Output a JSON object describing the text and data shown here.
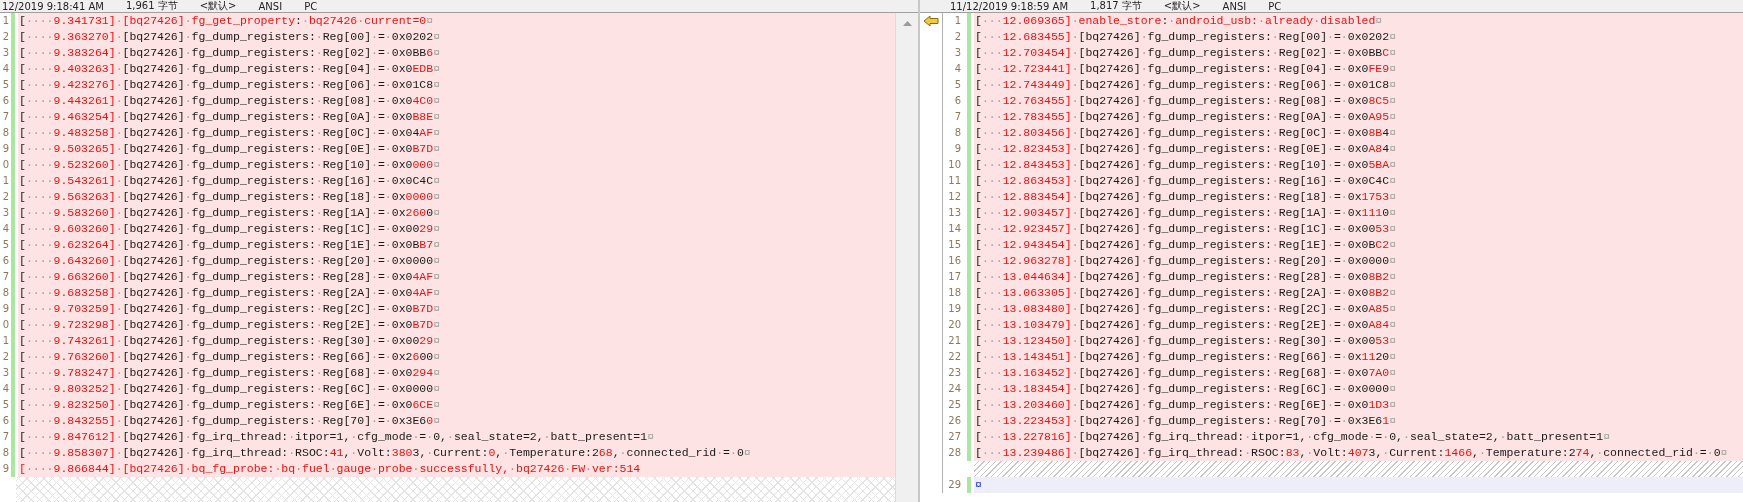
{
  "left": {
    "header": [
      "12/2019 9:18:41 AM",
      "1,961 字节",
      "<默认>",
      "ANSI",
      "PC"
    ],
    "lines": [
      {
        "num": "1",
        "kind": "changed",
        "segs": [
          {
            "text": "[····",
            "diff": false
          },
          {
            "text": "9.341731]",
            "diff": true
          },
          {
            "text": "·",
            "diff": false
          },
          {
            "text": "[bq27426]",
            "diff": true
          },
          {
            "text": "·",
            "diff": false
          },
          {
            "text": "fg_get_property",
            "diff": true
          },
          {
            "text": ":·",
            "diff": false
          },
          {
            "text": "bq27426·current=0",
            "diff": true
          },
          {
            "text": "¤",
            "diff": false
          }
        ]
      },
      {
        "num": "2",
        "kind": "changed",
        "segs": [
          {
            "text": "[····",
            "diff": false
          },
          {
            "text": "9.363270]",
            "diff": true
          },
          {
            "text": "·[bq27426]·fg_dump_registers:·Reg[00]·=·0x0202¤",
            "diff": false
          }
        ]
      },
      {
        "num": "3",
        "kind": "changed",
        "segs": [
          {
            "text": "[····",
            "diff": false
          },
          {
            "text": "9.383264]",
            "diff": true
          },
          {
            "text": "·[bq27426]·fg_dump_registers:·Reg[02]·=·0x0BB",
            "diff": false
          },
          {
            "text": "6",
            "diff": true
          },
          {
            "text": "¤",
            "diff": false
          }
        ]
      },
      {
        "num": "4",
        "kind": "changed",
        "segs": [
          {
            "text": "[····",
            "diff": false
          },
          {
            "text": "9.403263]",
            "diff": true
          },
          {
            "text": "·[bq27426]·fg_dump_registers:·Reg[04]·=·0x0",
            "diff": false
          },
          {
            "text": "EDB",
            "diff": true
          },
          {
            "text": "¤",
            "diff": false
          }
        ]
      },
      {
        "num": "5",
        "kind": "changed",
        "segs": [
          {
            "text": "[····",
            "diff": false
          },
          {
            "text": "9.423276]",
            "diff": true
          },
          {
            "text": "·[bq27426]·fg_dump_registers:·Reg[06]·=·0x01C8¤",
            "diff": false
          }
        ]
      },
      {
        "num": "6",
        "kind": "changed",
        "segs": [
          {
            "text": "[····",
            "diff": false
          },
          {
            "text": "9.443261]",
            "diff": true
          },
          {
            "text": "·[bq27426]·fg_dump_registers:·Reg[08]·=·0x0",
            "diff": false
          },
          {
            "text": "4C0",
            "diff": true
          },
          {
            "text": "¤",
            "diff": false
          }
        ]
      },
      {
        "num": "7",
        "kind": "changed",
        "segs": [
          {
            "text": "[····",
            "diff": false
          },
          {
            "text": "9.463254]",
            "diff": true
          },
          {
            "text": "·[bq27426]·fg_dump_registers:·Reg[0A]·=·0x0",
            "diff": false
          },
          {
            "text": "B8E",
            "diff": true
          },
          {
            "text": "¤",
            "diff": false
          }
        ]
      },
      {
        "num": "8",
        "kind": "changed",
        "segs": [
          {
            "text": "[····",
            "diff": false
          },
          {
            "text": "9.483258]",
            "diff": true
          },
          {
            "text": "·[bq27426]·fg_dump_registers:·Reg[0C]·=·0x04",
            "diff": false
          },
          {
            "text": "AF",
            "diff": true
          },
          {
            "text": "¤",
            "diff": false
          }
        ]
      },
      {
        "num": "9",
        "kind": "changed",
        "segs": [
          {
            "text": "[····",
            "diff": false
          },
          {
            "text": "9.503265]",
            "diff": true
          },
          {
            "text": "·[bq27426]·fg_dump_registers:·Reg[0E]·=·0x0",
            "diff": false
          },
          {
            "text": "B7D",
            "diff": true
          },
          {
            "text": "¤",
            "diff": false
          }
        ]
      },
      {
        "num": "0",
        "kind": "changed",
        "segs": [
          {
            "text": "[····",
            "diff": false
          },
          {
            "text": "9.523260]",
            "diff": true
          },
          {
            "text": "·[bq27426]·fg_dump_registers:·Reg[10]·=·0x0",
            "diff": false
          },
          {
            "text": "000",
            "diff": true
          },
          {
            "text": "¤",
            "diff": false
          }
        ]
      },
      {
        "num": "1",
        "kind": "changed",
        "segs": [
          {
            "text": "[····",
            "diff": false
          },
          {
            "text": "9.543261]",
            "diff": true
          },
          {
            "text": "·[bq27426]·fg_dump_registers:·Reg[16]·=·0x0C4C¤",
            "diff": false
          }
        ]
      },
      {
        "num": "2",
        "kind": "changed",
        "segs": [
          {
            "text": "[····",
            "diff": false
          },
          {
            "text": "9.563263]",
            "diff": true
          },
          {
            "text": "·[bq27426]·fg_dump_registers:·Reg[18]·=·0x",
            "diff": false
          },
          {
            "text": "0000",
            "diff": true
          },
          {
            "text": "¤",
            "diff": false
          }
        ]
      },
      {
        "num": "3",
        "kind": "changed",
        "segs": [
          {
            "text": "[····",
            "diff": false
          },
          {
            "text": "9.583260]",
            "diff": true
          },
          {
            "text": "·[bq27426]·fg_dump_registers:·Reg[1A]·=·0x",
            "diff": false
          },
          {
            "text": "260",
            "diff": true
          },
          {
            "text": "0¤",
            "diff": false
          }
        ]
      },
      {
        "num": "4",
        "kind": "changed",
        "segs": [
          {
            "text": "[····",
            "diff": false
          },
          {
            "text": "9.603260]",
            "diff": true
          },
          {
            "text": "·[bq27426]·fg_dump_registers:·Reg[1C]·=·0x00",
            "diff": false
          },
          {
            "text": "29",
            "diff": true
          },
          {
            "text": "¤",
            "diff": false
          }
        ]
      },
      {
        "num": "5",
        "kind": "changed",
        "segs": [
          {
            "text": "[····",
            "diff": false
          },
          {
            "text": "9.623264]",
            "diff": true
          },
          {
            "text": "·[bq27426]·fg_dump_registers:·Reg[1E]·=·0x0B",
            "diff": false
          },
          {
            "text": "B7",
            "diff": true
          },
          {
            "text": "¤",
            "diff": false
          }
        ]
      },
      {
        "num": "6",
        "kind": "changed",
        "segs": [
          {
            "text": "[····",
            "diff": false
          },
          {
            "text": "9.643260]",
            "diff": true
          },
          {
            "text": "·[bq27426]·fg_dump_registers:·Reg[20]·=·0x0000¤",
            "diff": false
          }
        ]
      },
      {
        "num": "7",
        "kind": "changed",
        "segs": [
          {
            "text": "[····",
            "diff": false
          },
          {
            "text": "9.663260]",
            "diff": true
          },
          {
            "text": "·[bq27426]·fg_dump_registers:·Reg[28]·=·0x0",
            "diff": false
          },
          {
            "text": "4AF",
            "diff": true
          },
          {
            "text": "¤",
            "diff": false
          }
        ]
      },
      {
        "num": "8",
        "kind": "changed",
        "segs": [
          {
            "text": "[····",
            "diff": false
          },
          {
            "text": "9.683258]",
            "diff": true
          },
          {
            "text": "·[bq27426]·fg_dump_registers:·Reg[2A]·=·0x0",
            "diff": false
          },
          {
            "text": "4AF",
            "diff": true
          },
          {
            "text": "¤",
            "diff": false
          }
        ]
      },
      {
        "num": "9",
        "kind": "changed",
        "segs": [
          {
            "text": "[····",
            "diff": false
          },
          {
            "text": "9.703259]",
            "diff": true
          },
          {
            "text": "·[bq27426]·fg_dump_registers:·Reg[2C]·=·0x0",
            "diff": false
          },
          {
            "text": "B7D",
            "diff": true
          },
          {
            "text": "¤",
            "diff": false
          }
        ]
      },
      {
        "num": "0",
        "kind": "changed",
        "segs": [
          {
            "text": "[····",
            "diff": false
          },
          {
            "text": "9.723298]",
            "diff": true
          },
          {
            "text": "·[bq27426]·fg_dump_registers:·Reg[2E]·=·0x0",
            "diff": false
          },
          {
            "text": "B7D",
            "diff": true
          },
          {
            "text": "¤",
            "diff": false
          }
        ]
      },
      {
        "num": "1",
        "kind": "changed",
        "segs": [
          {
            "text": "[····",
            "diff": false
          },
          {
            "text": "9.743261]",
            "diff": true
          },
          {
            "text": "·[bq27426]·fg_dump_registers:·Reg[30]·=·0x00",
            "diff": false
          },
          {
            "text": "29",
            "diff": true
          },
          {
            "text": "¤",
            "diff": false
          }
        ]
      },
      {
        "num": "2",
        "kind": "changed",
        "segs": [
          {
            "text": "[····",
            "diff": false
          },
          {
            "text": "9.763260]",
            "diff": true
          },
          {
            "text": "·[bq27426]·fg_dump_registers:·Reg[66]·=·0x2",
            "diff": false
          },
          {
            "text": "6",
            "diff": true
          },
          {
            "text": "00¤",
            "diff": false
          }
        ]
      },
      {
        "num": "3",
        "kind": "changed",
        "segs": [
          {
            "text": "[····",
            "diff": false
          },
          {
            "text": "9.783247]",
            "diff": true
          },
          {
            "text": "·[bq27426]·fg_dump_registers:·Reg[68]·=·0x0",
            "diff": false
          },
          {
            "text": "294",
            "diff": true
          },
          {
            "text": "¤",
            "diff": false
          }
        ]
      },
      {
        "num": "4",
        "kind": "changed",
        "segs": [
          {
            "text": "[····",
            "diff": false
          },
          {
            "text": "9.803252]",
            "diff": true
          },
          {
            "text": "·[bq27426]·fg_dump_registers:·Reg[6C]·=·0x0000¤",
            "diff": false
          }
        ]
      },
      {
        "num": "5",
        "kind": "changed",
        "segs": [
          {
            "text": "[····",
            "diff": false
          },
          {
            "text": "9.823250]",
            "diff": true
          },
          {
            "text": "·[bq27426]·fg_dump_registers:·Reg[6E]·=·0x0",
            "diff": false
          },
          {
            "text": "6CE",
            "diff": true
          },
          {
            "text": "¤",
            "diff": false
          }
        ]
      },
      {
        "num": "6",
        "kind": "changed",
        "segs": [
          {
            "text": "[····",
            "diff": false
          },
          {
            "text": "9.843255]",
            "diff": true
          },
          {
            "text": "·[bq27426]·fg_dump_registers:·Reg[70]·=·0x3E6",
            "diff": false
          },
          {
            "text": "0",
            "diff": true
          },
          {
            "text": "¤",
            "diff": false
          }
        ]
      },
      {
        "num": "7",
        "kind": "changed",
        "segs": [
          {
            "text": "[····",
            "diff": false
          },
          {
            "text": "9.847612]",
            "diff": true
          },
          {
            "text": "·[bq27426]·fg_irq_thread:·itpor=1,·cfg_mode·=·0,·seal_state=2,·batt_present=1¤",
            "diff": false
          }
        ]
      },
      {
        "num": "8",
        "kind": "changed",
        "segs": [
          {
            "text": "[····",
            "diff": false
          },
          {
            "text": "9.858307]",
            "diff": true
          },
          {
            "text": "·[bq27426]·fg_irq_thread:·RSOC:",
            "diff": false
          },
          {
            "text": "41",
            "diff": true
          },
          {
            "text": ",·Volt:",
            "diff": false
          },
          {
            "text": "380",
            "diff": true
          },
          {
            "text": "3,·Current:",
            "diff": false
          },
          {
            "text": "0",
            "diff": true
          },
          {
            "text": ",·Temperature:2",
            "diff": false
          },
          {
            "text": "68",
            "diff": true
          },
          {
            "text": ",·connected_rid·=·0¤",
            "diff": false
          }
        ]
      },
      {
        "num": "9",
        "kind": "changed",
        "segs": [
          {
            "text": "[····9.866844]·[bq27426]·bq_fg_probe:·bq·fuel·gauge·probe·successfully,·bq27426·FW·ver:514",
            "diff": true
          }
        ]
      }
    ]
  },
  "right": {
    "header": [
      "11/12/2019 9:18:59 AM",
      "1,817 字节",
      "<默认>",
      "ANSI",
      "PC"
    ],
    "lines": [
      {
        "num": "1",
        "kind": "changed",
        "current": true,
        "segs": [
          {
            "text": "[···",
            "diff": false
          },
          {
            "text": "12.069365]",
            "diff": true
          },
          {
            "text": "·",
            "diff": false
          },
          {
            "text": "enable_store",
            "diff": true
          },
          {
            "text": ":·",
            "diff": false
          },
          {
            "text": "android_usb:·already·disabled",
            "diff": true
          },
          {
            "text": "¤",
            "diff": false
          }
        ]
      },
      {
        "num": "2",
        "kind": "changed",
        "current": false,
        "segs": [
          {
            "text": "[···",
            "diff": false
          },
          {
            "text": "12.683455]",
            "diff": true
          },
          {
            "text": "·[bq27426]·fg_dump_registers:·Reg[00]·=·0x0202¤",
            "diff": false
          }
        ]
      },
      {
        "num": "3",
        "kind": "changed",
        "current": false,
        "segs": [
          {
            "text": "[···",
            "diff": false
          },
          {
            "text": "12.703454]",
            "diff": true
          },
          {
            "text": "·[bq27426]·fg_dump_registers:·Reg[02]·=·0x0BB",
            "diff": false
          },
          {
            "text": "C",
            "diff": true
          },
          {
            "text": "¤",
            "diff": false
          }
        ]
      },
      {
        "num": "4",
        "kind": "changed",
        "current": false,
        "segs": [
          {
            "text": "[···",
            "diff": false
          },
          {
            "text": "12.723441]",
            "diff": true
          },
          {
            "text": "·[bq27426]·fg_dump_registers:·Reg[04]·=·0x0",
            "diff": false
          },
          {
            "text": "FE9",
            "diff": true
          },
          {
            "text": "¤",
            "diff": false
          }
        ]
      },
      {
        "num": "5",
        "kind": "changed",
        "current": false,
        "segs": [
          {
            "text": "[···",
            "diff": false
          },
          {
            "text": "12.743449]",
            "diff": true
          },
          {
            "text": "·[bq27426]·fg_dump_registers:·Reg[06]·=·0x01C8¤",
            "diff": false
          }
        ]
      },
      {
        "num": "6",
        "kind": "changed",
        "current": false,
        "segs": [
          {
            "text": "[···",
            "diff": false
          },
          {
            "text": "12.763455]",
            "diff": true
          },
          {
            "text": "·[bq27426]·fg_dump_registers:·Reg[08]·=·0x0",
            "diff": false
          },
          {
            "text": "8C5",
            "diff": true
          },
          {
            "text": "¤",
            "diff": false
          }
        ]
      },
      {
        "num": "7",
        "kind": "changed",
        "current": false,
        "segs": [
          {
            "text": "[···",
            "diff": false
          },
          {
            "text": "12.783455]",
            "diff": true
          },
          {
            "text": "·[bq27426]·fg_dump_registers:·Reg[0A]·=·0x0",
            "diff": false
          },
          {
            "text": "A95",
            "diff": true
          },
          {
            "text": "¤",
            "diff": false
          }
        ]
      },
      {
        "num": "8",
        "kind": "changed",
        "current": false,
        "segs": [
          {
            "text": "[···",
            "diff": false
          },
          {
            "text": "12.803456]",
            "diff": true
          },
          {
            "text": "·[bq27426]·fg_dump_registers:·Reg[0C]·=·0x0",
            "diff": false
          },
          {
            "text": "8B",
            "diff": true
          },
          {
            "text": "4¤",
            "diff": false
          }
        ]
      },
      {
        "num": "9",
        "kind": "changed",
        "current": false,
        "segs": [
          {
            "text": "[···",
            "diff": false
          },
          {
            "text": "12.823453]",
            "diff": true
          },
          {
            "text": "·[bq27426]·fg_dump_registers:·Reg[0E]·=·0x0",
            "diff": false
          },
          {
            "text": "A8",
            "diff": true
          },
          {
            "text": "4¤",
            "diff": false
          }
        ]
      },
      {
        "num": "10",
        "kind": "changed",
        "current": false,
        "segs": [
          {
            "text": "[···",
            "diff": false
          },
          {
            "text": "12.843453]",
            "diff": true
          },
          {
            "text": "·[bq27426]·fg_dump_registers:·Reg[10]·=·0x0",
            "diff": false
          },
          {
            "text": "5BA",
            "diff": true
          },
          {
            "text": "¤",
            "diff": false
          }
        ]
      },
      {
        "num": "11",
        "kind": "changed",
        "current": false,
        "segs": [
          {
            "text": "[···",
            "diff": false
          },
          {
            "text": "12.863453]",
            "diff": true
          },
          {
            "text": "·[bq27426]·fg_dump_registers:·Reg[16]·=·0x0C4C¤",
            "diff": false
          }
        ]
      },
      {
        "num": "12",
        "kind": "changed",
        "current": false,
        "segs": [
          {
            "text": "[···",
            "diff": false
          },
          {
            "text": "12.883454]",
            "diff": true
          },
          {
            "text": "·[bq27426]·fg_dump_registers:·Reg[18]·=·0x",
            "diff": false
          },
          {
            "text": "1753",
            "diff": true
          },
          {
            "text": "¤",
            "diff": false
          }
        ]
      },
      {
        "num": "13",
        "kind": "changed",
        "current": false,
        "segs": [
          {
            "text": "[···",
            "diff": false
          },
          {
            "text": "12.903457]",
            "diff": true
          },
          {
            "text": "·[bq27426]·fg_dump_registers:·Reg[1A]·=·0x",
            "diff": false
          },
          {
            "text": "111",
            "diff": true
          },
          {
            "text": "0¤",
            "diff": false
          }
        ]
      },
      {
        "num": "14",
        "kind": "changed",
        "current": false,
        "segs": [
          {
            "text": "[···",
            "diff": false
          },
          {
            "text": "12.923457]",
            "diff": true
          },
          {
            "text": "·[bq27426]·fg_dump_registers:·Reg[1C]·=·0x00",
            "diff": false
          },
          {
            "text": "53",
            "diff": true
          },
          {
            "text": "¤",
            "diff": false
          }
        ]
      },
      {
        "num": "15",
        "kind": "changed",
        "current": false,
        "segs": [
          {
            "text": "[···",
            "diff": false
          },
          {
            "text": "12.943454]",
            "diff": true
          },
          {
            "text": "·[bq27426]·fg_dump_registers:·Reg[1E]·=·0x0B",
            "diff": false
          },
          {
            "text": "C2",
            "diff": true
          },
          {
            "text": "¤",
            "diff": false
          }
        ]
      },
      {
        "num": "16",
        "kind": "changed",
        "current": false,
        "segs": [
          {
            "text": "[···",
            "diff": false
          },
          {
            "text": "12.963278]",
            "diff": true
          },
          {
            "text": "·[bq27426]·fg_dump_registers:·Reg[20]·=·0x0000¤",
            "diff": false
          }
        ]
      },
      {
        "num": "17",
        "kind": "changed",
        "current": false,
        "segs": [
          {
            "text": "[···",
            "diff": false
          },
          {
            "text": "13.044634]",
            "diff": true
          },
          {
            "text": "·[bq27426]·fg_dump_registers:·Reg[28]·=·0x0",
            "diff": false
          },
          {
            "text": "8B2",
            "diff": true
          },
          {
            "text": "¤",
            "diff": false
          }
        ]
      },
      {
        "num": "18",
        "kind": "changed",
        "current": false,
        "segs": [
          {
            "text": "[···",
            "diff": false
          },
          {
            "text": "13.063305]",
            "diff": true
          },
          {
            "text": "·[bq27426]·fg_dump_registers:·Reg[2A]·=·0x0",
            "diff": false
          },
          {
            "text": "8B2",
            "diff": true
          },
          {
            "text": "¤",
            "diff": false
          }
        ]
      },
      {
        "num": "19",
        "kind": "changed",
        "current": false,
        "segs": [
          {
            "text": "[···",
            "diff": false
          },
          {
            "text": "13.083480]",
            "diff": true
          },
          {
            "text": "·[bq27426]·fg_dump_registers:·Reg[2C]·=·0x0",
            "diff": false
          },
          {
            "text": "A85",
            "diff": true
          },
          {
            "text": "¤",
            "diff": false
          }
        ]
      },
      {
        "num": "20",
        "kind": "changed",
        "current": false,
        "segs": [
          {
            "text": "[···",
            "diff": false
          },
          {
            "text": "13.103479]",
            "diff": true
          },
          {
            "text": "·[bq27426]·fg_dump_registers:·Reg[2E]·=·0x0",
            "diff": false
          },
          {
            "text": "A84",
            "diff": true
          },
          {
            "text": "¤",
            "diff": false
          }
        ]
      },
      {
        "num": "21",
        "kind": "changed",
        "current": false,
        "segs": [
          {
            "text": "[···",
            "diff": false
          },
          {
            "text": "13.123450]",
            "diff": true
          },
          {
            "text": "·[bq27426]·fg_dump_registers:·Reg[30]·=·0x00",
            "diff": false
          },
          {
            "text": "53",
            "diff": true
          },
          {
            "text": "¤",
            "diff": false
          }
        ]
      },
      {
        "num": "22",
        "kind": "changed",
        "current": false,
        "segs": [
          {
            "text": "[···",
            "diff": false
          },
          {
            "text": "13.143451]",
            "diff": true
          },
          {
            "text": "·[bq27426]·fg_dump_registers:·Reg[66]·=·0x",
            "diff": false
          },
          {
            "text": "11",
            "diff": true
          },
          {
            "text": "20¤",
            "diff": false
          }
        ]
      },
      {
        "num": "23",
        "kind": "changed",
        "current": false,
        "segs": [
          {
            "text": "[···",
            "diff": false
          },
          {
            "text": "13.163452]",
            "diff": true
          },
          {
            "text": "·[bq27426]·fg_dump_registers:·Reg[68]·=·0x0",
            "diff": false
          },
          {
            "text": "7A0",
            "diff": true
          },
          {
            "text": "¤",
            "diff": false
          }
        ]
      },
      {
        "num": "24",
        "kind": "changed",
        "current": false,
        "segs": [
          {
            "text": "[···",
            "diff": false
          },
          {
            "text": "13.183454]",
            "diff": true
          },
          {
            "text": "·[bq27426]·fg_dump_registers:·Reg[6C]·=·0x0000¤",
            "diff": false
          }
        ]
      },
      {
        "num": "25",
        "kind": "changed",
        "current": false,
        "segs": [
          {
            "text": "[···",
            "diff": false
          },
          {
            "text": "13.203460]",
            "diff": true
          },
          {
            "text": "·[bq27426]·fg_dump_registers:·Reg[6E]·=·0x0",
            "diff": false
          },
          {
            "text": "1D3",
            "diff": true
          },
          {
            "text": "¤",
            "diff": false
          }
        ]
      },
      {
        "num": "26",
        "kind": "changed",
        "current": false,
        "segs": [
          {
            "text": "[···",
            "diff": false
          },
          {
            "text": "13.223453]",
            "diff": true
          },
          {
            "text": "·[bq27426]·fg_dump_registers:·Reg[70]·=·0x3E6",
            "diff": false
          },
          {
            "text": "1",
            "diff": true
          },
          {
            "text": "¤",
            "diff": false
          }
        ]
      },
      {
        "num": "27",
        "kind": "changed",
        "current": false,
        "segs": [
          {
            "text": "[···",
            "diff": false
          },
          {
            "text": "13.227816]",
            "diff": true
          },
          {
            "text": "·[bq27426]·fg_irq_thread:·itpor=1,·cfg_mode·=·0,·seal_state=2,·batt_present=1¤",
            "diff": false
          }
        ]
      },
      {
        "num": "28",
        "kind": "changed",
        "current": false,
        "segs": [
          {
            "text": "[···",
            "diff": false
          },
          {
            "text": "13.239486]",
            "diff": true
          },
          {
            "text": "·[bq27426]·fg_irq_thread:·RSOC:",
            "diff": false
          },
          {
            "text": "83",
            "diff": true
          },
          {
            "text": ",·Volt:",
            "diff": false
          },
          {
            "text": "407",
            "diff": true
          },
          {
            "text": "3,·Current:",
            "diff": false
          },
          {
            "text": "1466",
            "diff": true
          },
          {
            "text": ",·Temperature:2",
            "diff": false
          },
          {
            "text": "74",
            "diff": true
          },
          {
            "text": ",·connected_rid·=·0¤",
            "diff": false
          }
        ]
      },
      {
        "kind": "gap",
        "current": false
      },
      {
        "num": "29",
        "kind": "blank",
        "current": false,
        "segs": [
          {
            "text": "¤",
            "diff": false
          }
        ]
      }
    ]
  }
}
